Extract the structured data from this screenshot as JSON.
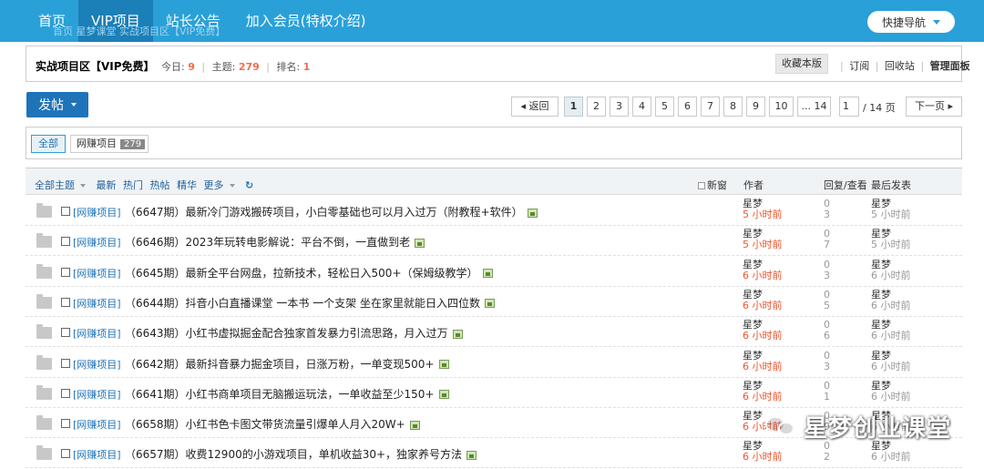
{
  "topnav": {
    "items": [
      "首页",
      "VIP项目",
      "站长公告",
      "加入会员(特权介绍)"
    ],
    "ghost_breadcrumb": "首页   星梦课堂   实战项目区【VIP免费】",
    "quicknav_label": "快捷导航"
  },
  "forum": {
    "title": "实战项目区【VIP免费】",
    "today_label": "今日:",
    "today": "9",
    "topics_label": "主题:",
    "topics": "279",
    "rank_label": "排名:",
    "rank": "1",
    "fav_label": "收藏本版",
    "subscribe_label": "订阅",
    "recycle_label": "回收站",
    "manage_label": "管理面板"
  },
  "toolbar": {
    "post_label": "发帖"
  },
  "pager": {
    "prev": "返回",
    "pages": [
      "1",
      "2",
      "3",
      "4",
      "5",
      "6",
      "7",
      "8",
      "9",
      "10"
    ],
    "last": "... 14",
    "input_value": "1",
    "total": "/ 14 页",
    "next": "下一页"
  },
  "categories": {
    "all": "全部",
    "wangzhuan": "网赚项目",
    "wangzhuan_count": "279"
  },
  "thead": {
    "all_topics": "全部主题",
    "latest": "最新",
    "hot": "热门",
    "hotpost": "热帖",
    "digest": "精华",
    "more": "更多",
    "refresh": "↻",
    "new_window": "新窗",
    "author": "作者",
    "reply_view": "回复/查看",
    "last_post": "最后发表"
  },
  "threads": [
    {
      "cat": "[网赚项目]",
      "subject": "（6647期）最新冷门游戏搬砖项目，小白零基础也可以月入过万（附教程+软件）",
      "author": "星梦",
      "time": "5 小时前",
      "replies": "0",
      "views": "3",
      "last_author": "星梦",
      "last_time": "5 小时前"
    },
    {
      "cat": "[网赚项目]",
      "subject": "（6646期）2023年玩转电影解说：平台不倒，一直做到老",
      "author": "星梦",
      "time": "5 小时前",
      "replies": "0",
      "views": "7",
      "last_author": "星梦",
      "last_time": "5 小时前"
    },
    {
      "cat": "[网赚项目]",
      "subject": "（6645期）最新全平台网盘，拉新技术，轻松日入500+（保姆级教学）",
      "author": "星梦",
      "time": "6 小时前",
      "replies": "0",
      "views": "3",
      "last_author": "星梦",
      "last_time": "6 小时前"
    },
    {
      "cat": "[网赚项目]",
      "subject": "（6644期）抖音小白直播课堂 一本书 一个支架 坐在家里就能日入四位数",
      "author": "星梦",
      "time": "6 小时前",
      "replies": "0",
      "views": "5",
      "last_author": "星梦",
      "last_time": "6 小时前"
    },
    {
      "cat": "[网赚项目]",
      "subject": "（6643期）小红书虚拟掘金配合独家首发暴力引流思路，月入过万",
      "author": "星梦",
      "time": "6 小时前",
      "replies": "0",
      "views": "6",
      "last_author": "星梦",
      "last_time": "6 小时前"
    },
    {
      "cat": "[网赚项目]",
      "subject": "（6642期）最新抖音暴力掘金项目，日涨万粉，一单变现500+",
      "author": "星梦",
      "time": "6 小时前",
      "replies": "0",
      "views": "3",
      "last_author": "星梦",
      "last_time": "6 小时前"
    },
    {
      "cat": "[网赚项目]",
      "subject": "（6641期）小红书商单项目无脑搬运玩法，一单收益至少150+",
      "author": "星梦",
      "time": "6 小时前",
      "replies": "0",
      "views": "1",
      "last_author": "星梦",
      "last_time": "6 小时前"
    },
    {
      "cat": "[网赚项目]",
      "subject": "（6658期）小红书色卡图文带货流量引爆单人月入20W+",
      "author": "星梦",
      "time": "6 小时前",
      "replies": "0",
      "views": "9",
      "last_author": "星梦",
      "last_time": "6 小时前"
    },
    {
      "cat": "[网赚项目]",
      "subject": "（6657期）收费12900的小游戏项目，单机收益30+，独家养号方法",
      "author": "星梦",
      "time": "6 小时前",
      "replies": "0",
      "views": "2",
      "last_author": "星梦",
      "last_time": "6 小时前"
    }
  ],
  "watermark": {
    "text": "星梦创业课堂"
  }
}
